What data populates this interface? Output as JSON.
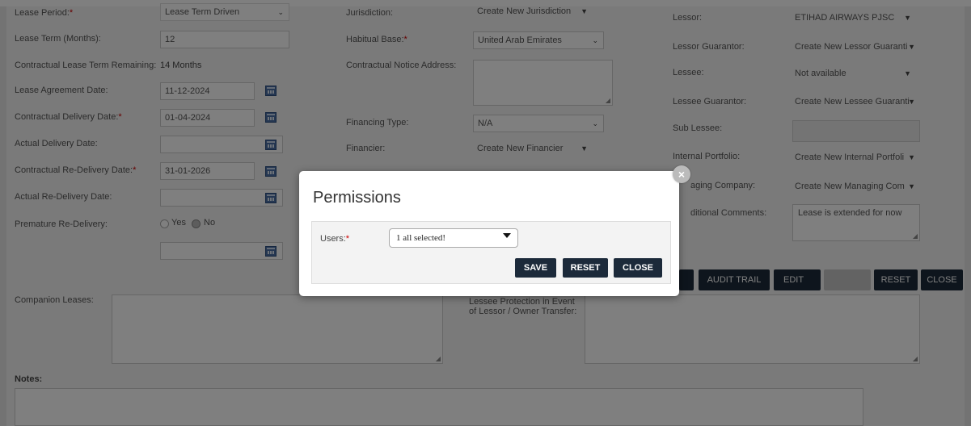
{
  "left": {
    "lease_period_label": "Lease Period:",
    "lease_period_value": "Lease Term Driven",
    "lease_term_label": "Lease Term (Months):",
    "lease_term_value": "12",
    "remaining_label": "Contractual Lease Term Remaining:",
    "remaining_value": "14 Months",
    "agreement_date_label": "Lease Agreement Date:",
    "agreement_date_value": "11-12-2024",
    "contract_delivery_label": "Contractual Delivery Date:",
    "contract_delivery_value": "01-04-2024",
    "actual_delivery_label": "Actual Delivery Date:",
    "actual_delivery_value": "",
    "contract_redelivery_label": "Contractual Re-Delivery Date:",
    "contract_redelivery_value": "31-01-2026",
    "actual_redelivery_label": "Actual Re-Delivery Date:",
    "actual_redelivery_value": "",
    "premature_label": "Premature Re-Delivery:",
    "yes_label": "Yes",
    "no_label": "No",
    "premature_date_value": ""
  },
  "middle": {
    "jurisdiction_label": "Jurisdiction:",
    "jurisdiction_value": "Create New Jurisdiction",
    "habitual_label": "Habitual Base:",
    "habitual_value": "United Arab Emirates",
    "notice_label": "Contractual Notice Address:",
    "notice_value": "",
    "financing_label": "Financing Type:",
    "financing_value": "N/A",
    "financier_label": "Financier:",
    "financier_value": "Create New Financier"
  },
  "right": {
    "lessor_label": "Lessor:",
    "lessor_value": "ETIHAD AIRWAYS PJSC",
    "lessor_guarantor_label": "Lessor Guarantor:",
    "lessor_guarantor_value": "Create New Lessor Guaranti",
    "lessee_label": "Lessee:",
    "lessee_value": "Not available",
    "lessee_guarantor_label": "Lessee Guarantor:",
    "lessee_guarantor_value": "Create New Lessee Guaranti",
    "sub_lessee_label": "Sub Lessee:",
    "sub_lessee_value": "",
    "internal_portfolio_label": "Internal Portfolio:",
    "internal_portfolio_value": "Create New Internal Portfoli",
    "managing_company_label": "aging Company:",
    "managing_company_value": "Create New Managing Com",
    "comments_label": "ditional Comments:",
    "comments_value": "Lease is extended for now"
  },
  "toolbar": {
    "audit_trail": "AUDIT TRAIL",
    "edit": "EDIT",
    "reset": "RESET",
    "close": "CLOSE"
  },
  "bottom": {
    "companion_label": "Companion Leases:",
    "lessee_protection_label": "Lessee Protection in Event of Lessor / Owner Transfer:",
    "notes_label": "Notes:"
  },
  "modal": {
    "title": "Permissions",
    "users_label": "Users:",
    "users_value": "1 all selected!",
    "save": "SAVE",
    "reset": "RESET",
    "close": "CLOSE",
    "close_x": "×"
  },
  "colors": {
    "button_bg": "#1c2a3a",
    "required": "#cc0000",
    "overlay": "rgba(0,0,0,0.5)"
  }
}
